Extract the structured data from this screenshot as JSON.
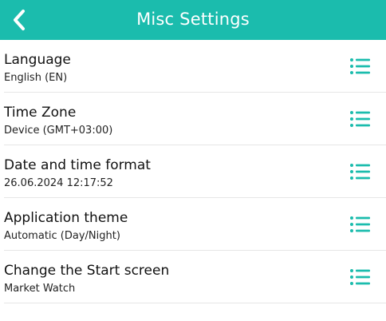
{
  "colors": {
    "accent": "#1bbcad",
    "header_text": "#ffffff",
    "divider": "#e6e6e6"
  },
  "header": {
    "title": "Misc Settings",
    "back_icon": "chevron-left-icon"
  },
  "settings": [
    {
      "title": "Language",
      "value": "English (EN)",
      "icon": "list-icon"
    },
    {
      "title": "Time Zone",
      "value": "Device (GMT+03:00)",
      "icon": "list-icon"
    },
    {
      "title": "Date and time format",
      "value": "26.06.2024 12:17:52",
      "icon": "list-icon"
    },
    {
      "title": "Application theme",
      "value": "Automatic (Day/Night)",
      "icon": "list-icon"
    },
    {
      "title": "Change the Start screen",
      "value": "Market Watch",
      "icon": "list-icon"
    }
  ]
}
